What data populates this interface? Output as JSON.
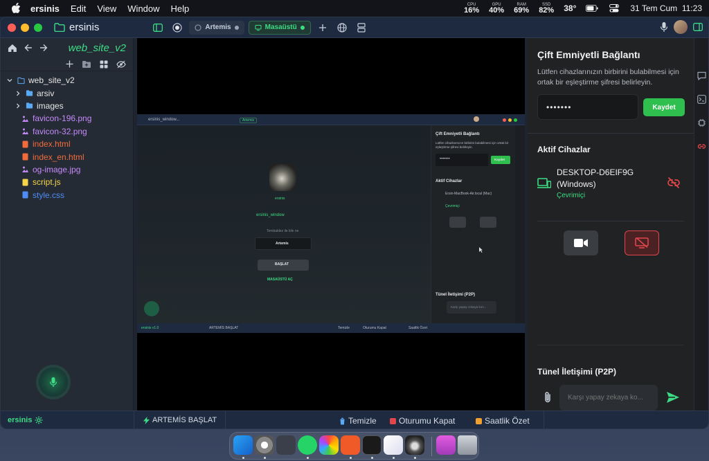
{
  "menubar": {
    "app": "ersinis",
    "items": [
      "Edit",
      "View",
      "Window",
      "Help"
    ],
    "stats": [
      {
        "label": "CPU",
        "value": "16%"
      },
      {
        "label": "GPU",
        "value": "40%"
      },
      {
        "label": "RAM",
        "value": "69%"
      },
      {
        "label": "SSD",
        "value": "82%"
      }
    ],
    "temp": "38°",
    "datetime": "31 Tem Cum  11:23"
  },
  "titlebar": {
    "title": "ersinis",
    "tabs": [
      {
        "label": "Artemis",
        "style": "grey"
      },
      {
        "label": "Masaüstü",
        "style": "green"
      }
    ]
  },
  "sidebar": {
    "title": "web_site_v2",
    "tree": [
      {
        "label": "web_site_v2",
        "kind": "root",
        "color": "#e6e6e6",
        "indent": 8
      },
      {
        "label": "arsiv",
        "kind": "folder",
        "color": "#e6e6e6",
        "indent": 20
      },
      {
        "label": "images",
        "kind": "folder",
        "color": "#e6e6e6",
        "indent": 20
      },
      {
        "label": "favicon-196.png",
        "kind": "img",
        "color": "#c58af9",
        "indent": 30
      },
      {
        "label": "favicon-32.png",
        "kind": "img",
        "color": "#c58af9",
        "indent": 30
      },
      {
        "label": "index.html",
        "kind": "html",
        "color": "#f26b3a",
        "indent": 30
      },
      {
        "label": "index_en.html",
        "kind": "html",
        "color": "#f26b3a",
        "indent": 30
      },
      {
        "label": "og-image.jpg",
        "kind": "img",
        "color": "#c58af9",
        "indent": 30
      },
      {
        "label": "script.js",
        "kind": "js",
        "color": "#f5d547",
        "indent": 30
      },
      {
        "label": "style.css",
        "kind": "css",
        "color": "#4d8df5",
        "indent": 30
      }
    ]
  },
  "screenshot": {
    "title": "ersinis_window...",
    "tab": "Artemis",
    "profile_name": "ersinis",
    "edit_name": "ersinis_window",
    "prompt": "Tembaldez ile kiln ne",
    "artemis_btn": "Artemis",
    "start_btn": "BAŞLAT",
    "desktop_link": "MASAÜSTÜ AÇ",
    "panel_title": "Çift Emniyetli Bağlantı",
    "panel_desc": "Lütfen cihazlarınızın birbirini bulabilmesi için ortak bir eşleştirme şifresi belirleyin.",
    "pass": "•••••••",
    "save": "Kaydet",
    "active": "Aktif Cihazlar",
    "device": "Ersin-MacBook-Air.local (Mac)",
    "device_status": "Çevrimiçi",
    "tunnel": "Tünel İletişimi (P2P)",
    "chat_ph": "Karşı yapay zekaya kon...",
    "foot_version": "ersinis v1.0",
    "foot_start": "ARTEMİS BAŞLAT",
    "foot_clear": "Temizle",
    "foot_close": "Oturumu Kapat",
    "foot_summary": "Saatlik Özet"
  },
  "panel": {
    "title": "Çift Emniyetli Bağlantı",
    "description": "Lütfen cihazlarınızın birbirini bulabilmesi için ortak bir eşleştirme şifresi belirleyin.",
    "password": "•••••••",
    "save_label": "Kaydet",
    "active_title": "Aktif Cihazlar",
    "device_name": "DESKTOP-D6EIF9G (Windows)",
    "device_status": "Çevrimiçi",
    "tunnel_title": "Tünel İletişimi (P2P)",
    "chat_placeholder": "Karşı yapay zekaya ko..."
  },
  "statusbar": {
    "app": "ersinis",
    "start": "ARTEMİS BAŞLAT",
    "clear": "Temizle",
    "logout": "Oturumu Kapat",
    "summary": "Saatlik Özet"
  },
  "colors": {
    "accent": "#3ddc84",
    "danger": "#e0464b",
    "save": "#2fbf4f"
  },
  "dock": [
    "finder-icon",
    "chrome-icon",
    "launchpad-icon",
    "whatsapp-icon",
    "photos-icon",
    "brave-icon",
    "terminal-icon",
    "arc-icon",
    "ersinis-icon",
    "folder-icon",
    "trash-icon"
  ]
}
